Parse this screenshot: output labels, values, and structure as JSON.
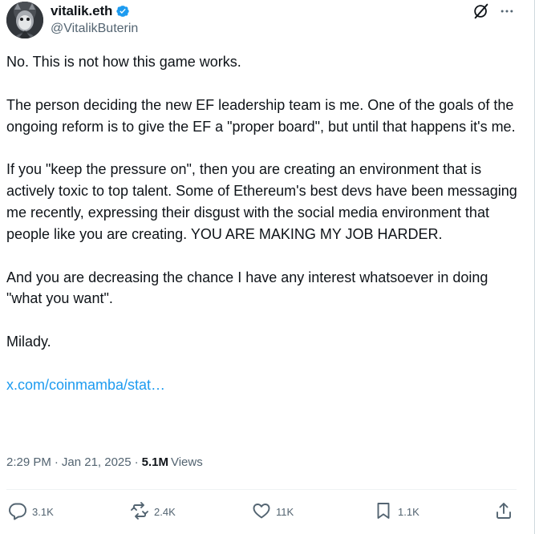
{
  "author": {
    "display_name": "vitalik.eth",
    "handle": "@VitalikButerin",
    "verified": true
  },
  "header": {
    "grok_icon": "grok-icon",
    "more_icon": "more-icon"
  },
  "body": {
    "paragraphs": [
      "No. This is not how this game works.",
      "The person deciding the new EF leadership team is me. One of the goals of the ongoing reform is to give the EF a \"proper board\", but until that happens it's me.",
      "If you \"keep the pressure on\", then you are creating an environment that is actively toxic to top talent. Some of Ethereum's best devs have been messaging me recently, expressing their disgust with the social media environment that people like you are creating. YOU ARE MAKING MY JOB HARDER.",
      "And you are decreasing the chance I have any interest whatsoever in doing \"what you want\".",
      "Milady."
    ],
    "link_text": "x.com/coinmamba/stat…"
  },
  "meta": {
    "time": "2:29 PM",
    "separator": "·",
    "date": "Jan 21, 2025",
    "views_count": "5.1M",
    "views_label": "Views"
  },
  "actions": {
    "reply": {
      "icon": "reply-icon",
      "count": "3.1K"
    },
    "repost": {
      "icon": "repost-icon",
      "count": "2.4K"
    },
    "like": {
      "icon": "heart-icon",
      "count": "11K"
    },
    "bookmark": {
      "icon": "bookmark-icon",
      "count": "1.1K"
    },
    "share": {
      "icon": "share-icon"
    }
  },
  "colors": {
    "text": "#0f1419",
    "secondary": "#536471",
    "link": "#1d9bf0",
    "verified": "#1d9bf0"
  }
}
